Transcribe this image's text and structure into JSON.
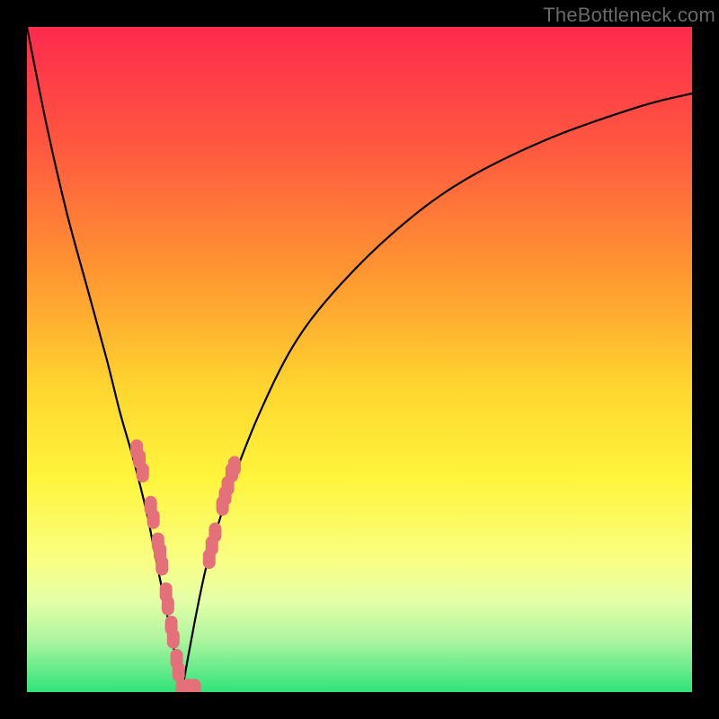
{
  "watermark": "TheBottleneck.com",
  "chart_data": {
    "type": "line",
    "title": "",
    "xlabel": "",
    "ylabel": "",
    "xlim": [
      0,
      100
    ],
    "ylim": [
      0,
      100
    ],
    "curve_left": {
      "x": [
        0,
        3,
        6,
        9,
        12,
        14,
        16,
        18,
        19,
        20,
        21,
        22,
        22.6,
        23,
        23.3
      ],
      "y": [
        100,
        85,
        72,
        61,
        50,
        42,
        35,
        27,
        22,
        17,
        12,
        7,
        3.5,
        1.5,
        0
      ]
    },
    "curve_right": {
      "x": [
        23.3,
        24,
        25.5,
        27,
        29,
        31,
        35,
        40,
        46,
        55,
        65,
        78,
        92,
        100
      ],
      "y": [
        0,
        4,
        12,
        19,
        26,
        32,
        42,
        52,
        60,
        69,
        76.5,
        83,
        88,
        90
      ]
    },
    "markers": [
      {
        "x": 16.5,
        "y": 36.5
      },
      {
        "x": 16.9,
        "y": 35.0
      },
      {
        "x": 17.4,
        "y": 33.0
      },
      {
        "x": 18.6,
        "y": 28.0
      },
      {
        "x": 19.0,
        "y": 26.0
      },
      {
        "x": 19.7,
        "y": 22.5
      },
      {
        "x": 20.0,
        "y": 21.0
      },
      {
        "x": 20.3,
        "y": 19.0
      },
      {
        "x": 20.9,
        "y": 15.0
      },
      {
        "x": 21.2,
        "y": 13.0
      },
      {
        "x": 21.7,
        "y": 10.0
      },
      {
        "x": 22.0,
        "y": 8.0
      },
      {
        "x": 22.5,
        "y": 5.0
      },
      {
        "x": 22.8,
        "y": 3.0
      },
      {
        "x": 23.3,
        "y": 0.5
      },
      {
        "x": 24.3,
        "y": 0.5
      },
      {
        "x": 25.2,
        "y": 0.5
      },
      {
        "x": 27.4,
        "y": 20.0
      },
      {
        "x": 27.8,
        "y": 22.0
      },
      {
        "x": 28.3,
        "y": 24.0
      },
      {
        "x": 29.4,
        "y": 28.0
      },
      {
        "x": 29.8,
        "y": 29.5
      },
      {
        "x": 30.2,
        "y": 31.0
      },
      {
        "x": 30.8,
        "y": 33.0
      },
      {
        "x": 31.2,
        "y": 34.0
      }
    ],
    "marker_color": "#e4717a"
  }
}
